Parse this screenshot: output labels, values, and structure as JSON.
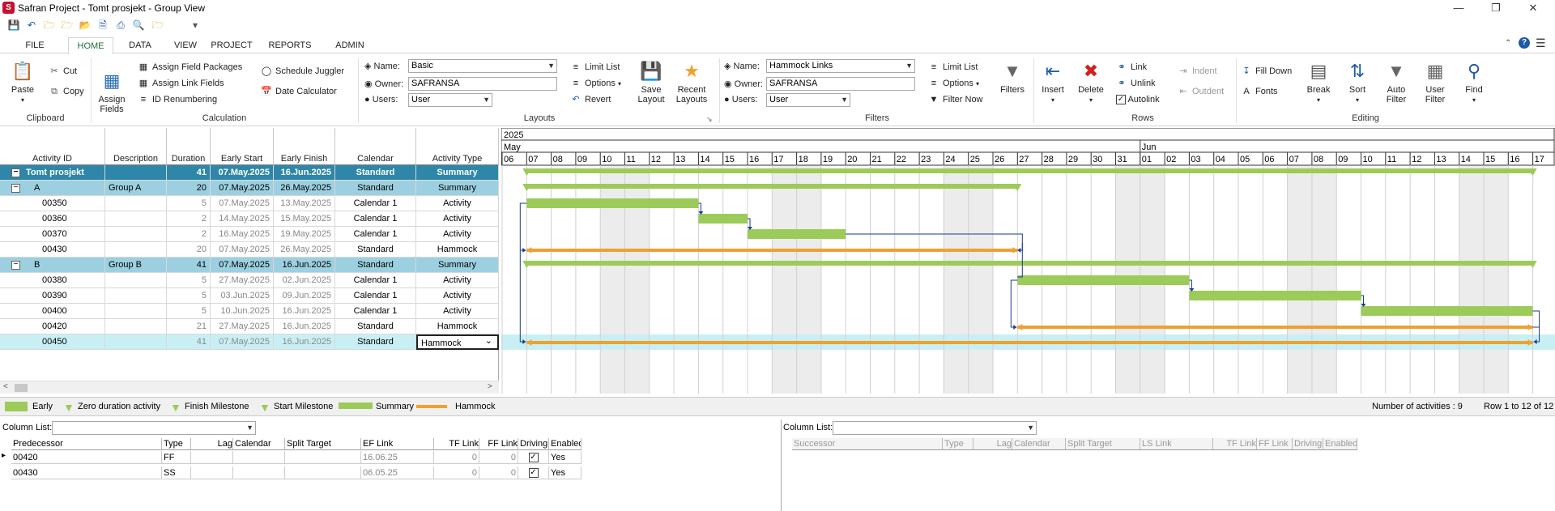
{
  "window": {
    "title": "Safran Project - Tomt prosjekt - Group View",
    "logo": "app-logo-icon"
  },
  "ribbon_tabs": [
    "FILE",
    "HOME",
    "DATA",
    "VIEW",
    "PROJECT",
    "REPORTS",
    "ADMIN"
  ],
  "ribbon": {
    "clipboard": {
      "paste": "Paste",
      "cut": "Cut",
      "copy": "Copy",
      "label": "Clipboard"
    },
    "calculation": {
      "assign_fields": "Assign\nFields",
      "assign_field_packages": "Assign Field Packages",
      "assign_link_fields": "Assign Link Fields",
      "id_renumbering": "ID Renumbering",
      "schedule_juggler": "Schedule Juggler",
      "date_calculator": "Date Calculator",
      "label": "Calculation"
    },
    "layouts": {
      "name_label": "Name:",
      "name_value": "Basic",
      "owner_label": "Owner:",
      "owner_value": "SAFRANSA",
      "users_label": "Users:",
      "users_value": "User",
      "limit_list": "Limit List",
      "options": "Options",
      "revert": "Revert",
      "save_layout": "Save\nLayout",
      "recent_layouts": "Recent\nLayouts",
      "label": "Layouts"
    },
    "filters": {
      "name_label": "Name:",
      "name_value": "Hammock Links",
      "owner_label": "Owner:",
      "owner_value": "SAFRANSA",
      "users_label": "Users:",
      "users_value": "User",
      "limit_list": "Limit List",
      "options": "Options",
      "filter_now": "Filter Now",
      "filters": "Filters",
      "label": "Filters"
    },
    "rows": {
      "insert": "Insert",
      "delete": "Delete",
      "link": "Link",
      "unlink": "Unlink",
      "autolink": "Autolink",
      "indent": "Indent",
      "outdent": "Outdent",
      "label": "Rows"
    },
    "editing": {
      "fill_down": "Fill Down",
      "fonts": "Fonts",
      "break": "Break",
      "sort": "Sort",
      "auto_filter": "Auto\nFilter",
      "user_filter": "User\nFilter",
      "find": "Find",
      "label": "Editing"
    }
  },
  "grid": {
    "columns": [
      "Activity ID",
      "Description",
      "Duration",
      "Early Start",
      "Early Finish",
      "Calendar",
      "Activity Type"
    ],
    "rows": [
      {
        "kind": "top",
        "id": "Tomt prosjekt",
        "desc": "",
        "dur": "41",
        "es": "07.May.2025",
        "ef": "16.Jun.2025",
        "cal": "Standard",
        "type": "Summary"
      },
      {
        "kind": "sum",
        "id": "A",
        "desc": "Group A",
        "dur": "20",
        "es": "07.May.2025",
        "ef": "26.May.2025",
        "cal": "Standard",
        "type": "Summary"
      },
      {
        "kind": "act",
        "id": "00350",
        "desc": "",
        "dur": "5",
        "es": "07.May.2025",
        "ef": "13.May.2025",
        "cal": "Calendar 1",
        "type": "Activity"
      },
      {
        "kind": "act",
        "id": "00360",
        "desc": "",
        "dur": "2",
        "es": "14.May.2025",
        "ef": "15.May.2025",
        "cal": "Calendar 1",
        "type": "Activity"
      },
      {
        "kind": "act",
        "id": "00370",
        "desc": "",
        "dur": "2",
        "es": "16.May.2025",
        "ef": "19.May.2025",
        "cal": "Calendar 1",
        "type": "Activity"
      },
      {
        "kind": "act",
        "id": "00430",
        "desc": "",
        "dur": "20",
        "es": "07.May.2025",
        "ef": "26.May.2025",
        "cal": "Standard",
        "type": "Hammock"
      },
      {
        "kind": "sum",
        "id": "B",
        "desc": "Group B",
        "dur": "41",
        "es": "07.May.2025",
        "ef": "16.Jun.2025",
        "cal": "Standard",
        "type": "Summary"
      },
      {
        "kind": "act",
        "id": "00380",
        "desc": "",
        "dur": "5",
        "es": "27.May.2025",
        "ef": "02.Jun.2025",
        "cal": "Calendar 1",
        "type": "Activity"
      },
      {
        "kind": "act",
        "id": "00390",
        "desc": "",
        "dur": "5",
        "es": "03.Jun.2025",
        "ef": "09.Jun.2025",
        "cal": "Calendar 1",
        "type": "Activity"
      },
      {
        "kind": "act",
        "id": "00400",
        "desc": "",
        "dur": "5",
        "es": "10.Jun.2025",
        "ef": "16.Jun.2025",
        "cal": "Calendar 1",
        "type": "Activity"
      },
      {
        "kind": "act",
        "id": "00420",
        "desc": "",
        "dur": "21",
        "es": "27.May.2025",
        "ef": "16.Jun.2025",
        "cal": "Standard",
        "type": "Hammock"
      },
      {
        "kind": "sel",
        "id": "00450",
        "desc": "",
        "dur": "41",
        "es": "07.May.2025",
        "ef": "16.Jun.2025",
        "cal": "Standard",
        "type": "Hammock"
      }
    ]
  },
  "gantt": {
    "year": "2025",
    "months": [
      {
        "label": "May",
        "start": 0
      },
      {
        "label": "Jun",
        "start": 26
      }
    ],
    "days": [
      "06",
      "07",
      "08",
      "09",
      "10",
      "11",
      "12",
      "13",
      "14",
      "15",
      "16",
      "17",
      "18",
      "19",
      "20",
      "21",
      "22",
      "23",
      "24",
      "25",
      "26",
      "27",
      "28",
      "29",
      "30",
      "31",
      "01",
      "02",
      "03",
      "04",
      "05",
      "06",
      "07",
      "08",
      "09",
      "10",
      "11",
      "12",
      "13",
      "14",
      "15",
      "16",
      "17"
    ],
    "weekend_cols": [
      4,
      5,
      11,
      12,
      18,
      19,
      25,
      26,
      32,
      33,
      39,
      40
    ],
    "bars": [
      {
        "row": 0,
        "kind": "summary",
        "start": 1,
        "end": 42
      },
      {
        "row": 1,
        "kind": "summary",
        "start": 1,
        "end": 21
      },
      {
        "row": 2,
        "kind": "early",
        "start": 1,
        "end": 8
      },
      {
        "row": 3,
        "kind": "early",
        "start": 8,
        "end": 10
      },
      {
        "row": 4,
        "kind": "early",
        "start": 10,
        "end": 14
      },
      {
        "row": 5,
        "kind": "hammock",
        "start": 1,
        "end": 21
      },
      {
        "row": 6,
        "kind": "summary",
        "start": 1,
        "end": 42
      },
      {
        "row": 7,
        "kind": "early",
        "start": 21,
        "end": 28
      },
      {
        "row": 8,
        "kind": "early",
        "start": 28,
        "end": 35
      },
      {
        "row": 9,
        "kind": "early",
        "start": 35,
        "end": 42
      },
      {
        "row": 10,
        "kind": "hammock",
        "start": 21,
        "end": 42
      },
      {
        "row": 11,
        "kind": "hammock",
        "start": 1,
        "end": 42
      }
    ],
    "colors": {
      "early": "#9ccb5a",
      "summary": "#9ccb5a",
      "hammock": "#f0a030",
      "link": "#1a3a8a",
      "weekend": "#ececec",
      "selected": "#c8f0f4"
    }
  },
  "legend": {
    "items": [
      "Early",
      "Zero duration activity",
      "Finish Milestone",
      "Start Milestone",
      "Summary",
      "Hammock"
    ],
    "count_text": "Number of activities : 9",
    "rows_text": "Row 1 to 12 of 12"
  },
  "pred": {
    "column_list_label": "Column List:",
    "columns": [
      "Predecessor",
      "Type",
      "Lag",
      "Calendar",
      "Split Target",
      "EF Link",
      "TF Link",
      "FF Link",
      "Driving",
      "Enabled"
    ],
    "rows": [
      {
        "pred": "00420",
        "type": "FF",
        "lag": "",
        "cal": "",
        "split": "",
        "ef": "16.06.25",
        "tf": "0",
        "ff": "0",
        "enabled": "Yes"
      },
      {
        "pred": "00430",
        "type": "SS",
        "lag": "",
        "cal": "",
        "split": "",
        "ef": "06.05.25",
        "tf": "0",
        "ff": "0",
        "enabled": "Yes"
      }
    ]
  },
  "succ": {
    "column_list_label": "Column List:",
    "columns": [
      "Successor",
      "Type",
      "Lag",
      "Calendar",
      "Split Target",
      "LS Link",
      "TF Link",
      "FF Link",
      "Driving",
      "Enabled"
    ]
  }
}
